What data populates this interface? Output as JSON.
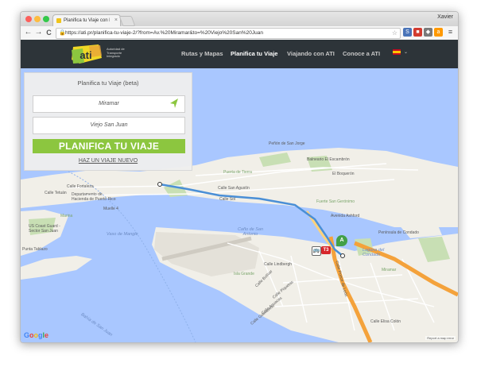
{
  "browser": {
    "tab_title": "Planifica tu Viaje con la Au",
    "tab_close": "×",
    "user_name": "Xavier",
    "url": "https://ati.pr/planifica-tu-viaje-2/?from=Av.%20Miramar&to=%20Viejo%20San%20Juan",
    "back": "←",
    "forward": "→",
    "reload": "C",
    "star": "☆"
  },
  "site": {
    "logo_lines": [
      "Autoridad de",
      "Transporte",
      "Integrado"
    ],
    "nav": [
      {
        "label": "Rutas y Mapas",
        "active": false
      },
      {
        "label": "Planifica tu Viaje",
        "active": true
      },
      {
        "label": "Viajando con ATI",
        "active": false
      },
      {
        "label": "Conoce a ATI",
        "active": false
      }
    ]
  },
  "planner": {
    "title": "Planifica tu Viaje (beta)",
    "from_value": "Miramar",
    "to_value": "Viejo San Juan",
    "submit_label": "PLANIFICA TU VIAJE",
    "new_trip_label": "HAZ UN VIAJE NUEVO"
  },
  "map": {
    "labels": [
      {
        "text": "Peñón de San Jorge"
      },
      {
        "text": "Balneario El Escambrón"
      },
      {
        "text": "El Boquerón"
      },
      {
        "text": "Puerta de Tierra"
      },
      {
        "text": "Fuerte San Gerónimo"
      },
      {
        "text": "Calle Fortaleza"
      },
      {
        "text": "Calle Tetuán"
      },
      {
        "text": "Departamento de Hacienda de Puerto Rico"
      },
      {
        "text": "Muelle 4"
      },
      {
        "text": "Marina"
      },
      {
        "text": "US Coast Guard - Sector San Juan"
      },
      {
        "text": "Vaso de Mangle"
      },
      {
        "text": "Caño de San Antonio"
      },
      {
        "text": "Laguna del Condado"
      },
      {
        "text": "Península de Condado"
      },
      {
        "text": "Miramar"
      },
      {
        "text": "Isla Grande"
      },
      {
        "text": "Bahía de San Juan"
      },
      {
        "text": "Calle San Agustín"
      },
      {
        "text": "Calle Sol"
      },
      {
        "text": "Avenida Ashford"
      },
      {
        "text": "Calle Lindbergh"
      },
      {
        "text": "Calle Ponce de León"
      },
      {
        "text": "Calle Bolívar"
      },
      {
        "text": "Punta Tablazo"
      },
      {
        "text": "Calle Piquetas"
      },
      {
        "text": "Calle Aguacas"
      },
      {
        "text": "Calle Guavaves"
      },
      {
        "text": "Calle Elisa Colón"
      }
    ],
    "google_letters": [
      "G",
      "o",
      "o",
      "g",
      "l",
      "e"
    ],
    "report_label": "Report a map error",
    "marker_a": "A",
    "marker_t3": "T3"
  },
  "colors": {
    "nav_bg": "#2d3439",
    "accent_green": "#8cc63f",
    "water": "#a9c7ff",
    "land": "#f1efe8",
    "route_blue": "#4a8fd6",
    "highway_orange": "#f4a23b"
  }
}
